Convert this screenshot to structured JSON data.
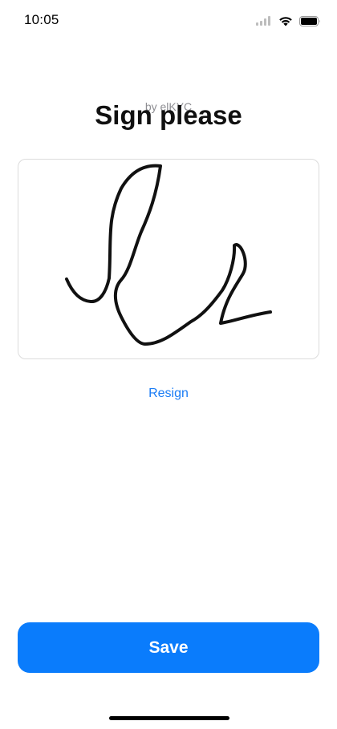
{
  "status_bar": {
    "time": "10:05",
    "icons": [
      "signal-icon",
      "wifi-icon",
      "battery-icon"
    ]
  },
  "header": {
    "subtitle": "by elKYC",
    "title": "Sign please"
  },
  "signature_pad": {
    "has_signature": true,
    "stroke_color": "#111111"
  },
  "actions": {
    "resign_label": "Resign",
    "save_label": "Save"
  },
  "colors": {
    "accent": "#0a7cfc",
    "link": "#1a7cf5",
    "subtitle": "#8e8e93",
    "title": "#111111",
    "pad_border": "#dcdcdc"
  }
}
